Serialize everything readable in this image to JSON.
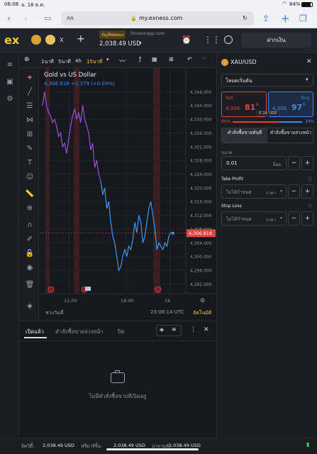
{
  "status_bar": {
    "time": "06:08",
    "date": "อ. 16 ธ.ค.",
    "battery": "84%"
  },
  "browser": {
    "aa_label": "กก",
    "url": "my.exness.com"
  },
  "header": {
    "logo": "ex",
    "tab_close": "X",
    "account_type": "บัญชีทดลอง",
    "account_server": "forexonapp.com",
    "balance": "2,038.49 USD",
    "deposit_label": "ฝากเงิน"
  },
  "chart_toolbar": {
    "timeframes": [
      "1นาที",
      "5นาที",
      "4h",
      "15นาที"
    ],
    "active_timeframe": "15นาที"
  },
  "chart_data": {
    "type": "line",
    "title": "Gold vs US Dollar",
    "last_price_label": "4,306.816",
    "change_label": "+1.379 (+0.03%)",
    "y_ticks": [
      "4,348.000",
      "4,344.000",
      "4,340.000",
      "4,336.000",
      "4,332.000",
      "4,328.000",
      "4,324.000",
      "4,320.000",
      "4,316.000",
      "4,312.000",
      "4,308.000",
      "4,304.000",
      "4,300.000",
      "4,296.000",
      "4,292.000"
    ],
    "x_ticks": [
      "12:00",
      "18:00",
      "16"
    ],
    "ylim": [
      4290.0,
      4352.0
    ],
    "series_purple": [
      [
        0,
        4344
      ],
      [
        1,
        4348
      ],
      [
        2,
        4344
      ],
      [
        3,
        4342
      ],
      [
        4,
        4341
      ],
      [
        5,
        4339
      ],
      [
        6,
        4340
      ],
      [
        7,
        4338
      ],
      [
        8,
        4335
      ],
      [
        9,
        4336
      ],
      [
        10,
        4332
      ],
      [
        11,
        4333
      ],
      [
        12,
        4330
      ],
      [
        13,
        4334
      ],
      [
        14,
        4338
      ],
      [
        15,
        4341
      ],
      [
        16,
        4343
      ],
      [
        17,
        4340
      ],
      [
        18,
        4342
      ],
      [
        19,
        4339
      ],
      [
        20,
        4344
      ],
      [
        21,
        4340
      ],
      [
        22,
        4338
      ],
      [
        23,
        4336
      ],
      [
        24,
        4331
      ],
      [
        25,
        4333
      ],
      [
        26,
        4326
      ],
      [
        27,
        4328
      ],
      [
        28,
        4324
      ],
      [
        29,
        4322
      ]
    ],
    "series_blue": [
      [
        29,
        4322
      ],
      [
        30,
        4318
      ],
      [
        31,
        4320
      ],
      [
        32,
        4314
      ],
      [
        33,
        4316
      ],
      [
        34,
        4310
      ],
      [
        35,
        4306
      ],
      [
        36,
        4304
      ],
      [
        37,
        4300
      ],
      [
        38,
        4296
      ],
      [
        39,
        4297
      ],
      [
        40,
        4300
      ],
      [
        41,
        4302
      ],
      [
        42,
        4300
      ],
      [
        43,
        4303
      ],
      [
        44,
        4302
      ],
      [
        45,
        4305
      ],
      [
        46,
        4310
      ],
      [
        47,
        4307
      ],
      [
        48,
        4312
      ],
      [
        49,
        4310
      ],
      [
        50,
        4304
      ],
      [
        51,
        4306
      ],
      [
        52,
        4310
      ],
      [
        53,
        4314
      ],
      [
        54,
        4316
      ],
      [
        55,
        4312
      ],
      [
        56,
        4308
      ],
      [
        57,
        4302
      ],
      [
        58,
        4304
      ],
      [
        59,
        4303
      ],
      [
        60,
        4302
      ],
      [
        61,
        4304
      ],
      [
        62,
        4303
      ],
      [
        63,
        4306
      ],
      [
        64,
        4307
      ],
      [
        65,
        4306.8
      ]
    ],
    "time_label": "23:08:14 UTC",
    "period_label": "ช่วงวันที่",
    "auto_label": "อัตโนมัติ"
  },
  "panel": {
    "symbol": "XAU/USD",
    "mode": "โหมดเริ่มต้น",
    "sell_label": "Sell",
    "buy_label": "Buy",
    "sell_price_main": "4,306.",
    "sell_price_big": "81",
    "sell_price_sup": "6",
    "buy_price_main": "4,306.",
    "buy_price_big": "97",
    "buy_price_sup": "6",
    "spread": "0.16 USD",
    "sell_pct": "66%",
    "buy_pct": "34%",
    "sell_share": 0.66,
    "market_order": "คำสั่งซื้อขายทันที",
    "pending_order": "คำสั่งซื้อขายล่วงหน้า",
    "volume_label": "ขนาด",
    "volume_value": "0.01",
    "volume_unit": "ล็อต",
    "tp_label": "Take Profit",
    "sl_label": "Stop Loss",
    "not_set": "ไม่ได้กำหนด",
    "price_unit": "ราคา"
  },
  "orders": {
    "tabs": [
      "เปิดแล้ว",
      "คำสั่งซื้อขายล่วงหน้า",
      "ปิด"
    ],
    "empty_text": "ไม่มีคำสั่งซื้อขายที่เปิดอยู่"
  },
  "footer": {
    "equity_label": "อิควิตี้:",
    "equity": "2,038.49 USD",
    "free_margin_label": "ฟรีมาร์จิ้น:",
    "free_margin": "2,038.49 USD",
    "balance_label": "บาลานซ์:",
    "balance": "2,038.49 USD"
  },
  "colors": {
    "accent": "#f6c93b",
    "sell": "#e0453f",
    "buy": "#3a8bf0",
    "purple": "#9b4ee3",
    "blue": "#3d97f2",
    "bg": "#16181d"
  }
}
